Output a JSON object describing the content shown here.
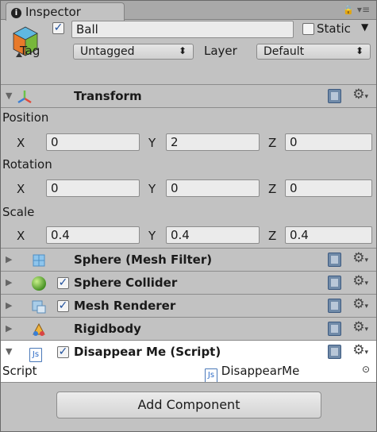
{
  "tab": {
    "info_glyph": "i",
    "title": "Inspector",
    "lock_glyph": "🔒",
    "menu_glyph": "▾≡"
  },
  "object": {
    "active": true,
    "name": "Ball",
    "static_label": "Static",
    "static_checked": false,
    "tag_label": "Tag",
    "tag_value": "Untagged",
    "layer_label": "Layer",
    "layer_value": "Default"
  },
  "transform": {
    "title": "Transform",
    "position_label": "Position",
    "rotation_label": "Rotation",
    "scale_label": "Scale",
    "x_label": "X",
    "y_label": "Y",
    "z_label": "Z",
    "position": {
      "x": "0",
      "y": "2",
      "z": "0"
    },
    "rotation": {
      "x": "0",
      "y": "0",
      "z": "0"
    },
    "scale": {
      "x": "0.4",
      "y": "0.4",
      "z": "0.4"
    }
  },
  "components": [
    {
      "title": "Sphere (Mesh Filter)",
      "has_checkbox": false,
      "icon": "mesh-filter-icon"
    },
    {
      "title": "Sphere Collider",
      "has_checkbox": true,
      "icon": "sphere-collider-icon"
    },
    {
      "title": "Mesh Renderer",
      "has_checkbox": true,
      "icon": "mesh-renderer-icon"
    },
    {
      "title": "Rigidbody",
      "has_checkbox": false,
      "icon": "rigidbody-icon"
    }
  ],
  "script_component": {
    "title": "Disappear Me (Script)",
    "field_label": "Script",
    "field_value": "DisappearMe",
    "js_glyph": "Js",
    "picker_glyph": "⊙"
  },
  "add_component_label": "Add Component",
  "colors": {
    "panel_bg": "#c2c2c2",
    "selected_header_bg": "#ffffff",
    "checkbox_tick": "#1e4f9c"
  }
}
